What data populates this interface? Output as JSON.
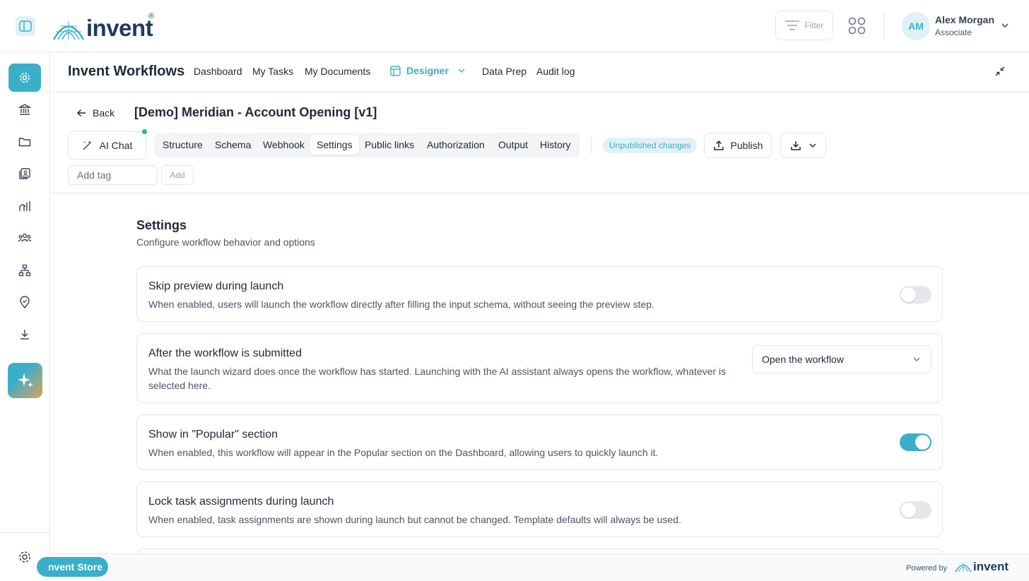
{
  "brand": {
    "name": "invent",
    "reg": "®"
  },
  "header": {
    "filter_label": "Filter",
    "user": {
      "initials": "AM",
      "name": "Alex Morgan",
      "role": "Associate"
    }
  },
  "nav": {
    "app_title": "Invent Workflows",
    "links": [
      "Dashboard",
      "My Tasks",
      "My Documents",
      "Designer",
      "Data Prep",
      "Audit log"
    ]
  },
  "workflow": {
    "back_label": "Back",
    "title": "[Demo] Meridian - Account Opening [v1]",
    "ai_chat_label": "AI Chat",
    "tabs": [
      "Structure",
      "Schema",
      "Webhook",
      "Settings",
      "Public links",
      "Authorization",
      "Output",
      "History"
    ],
    "active_tab": "Settings",
    "status_badge": "Unpublished changes",
    "publish_label": "Publish",
    "tag_placeholder": "Add tag",
    "tag_add_label": "Add"
  },
  "settings": {
    "title": "Settings",
    "subtitle": "Configure workflow behavior and options",
    "items": [
      {
        "title": "Skip preview during launch",
        "desc": "When enabled, users will launch the workflow directly after filling the input schema, without seeing the preview step.",
        "enabled": false
      },
      {
        "title": "After the workflow is submitted",
        "desc": "What the launch wizard does once the workflow has started. Launching with the AI assistant always opens the workflow, whatever is selected here.",
        "select_value": "Open the workflow"
      },
      {
        "title": "Show in \"Popular\" section",
        "desc": "When enabled, this workflow will appear in the Popular section on the Dashboard, allowing users to quickly launch it.",
        "enabled": true
      },
      {
        "title": "Lock task assignments during launch",
        "desc": "When enabled, task assignments are shown during launch but cannot be changed. Template defaults will always be used.",
        "enabled": false
      }
    ]
  },
  "footer": {
    "store_label": "nvent Store",
    "powered_by": "Powered by",
    "logo_text": "invent"
  },
  "colors": {
    "accent": "#3aafc9",
    "brand_dark": "#1e3a5f",
    "success": "#22c55e"
  },
  "icons": {
    "sidebar": [
      "gear-icon",
      "bank-icon",
      "folder-icon",
      "documents-icon",
      "chart-icon",
      "users-icon",
      "hierarchy-icon",
      "location-icon",
      "download-icon",
      "sparkle-icon",
      "settings-icon"
    ]
  }
}
